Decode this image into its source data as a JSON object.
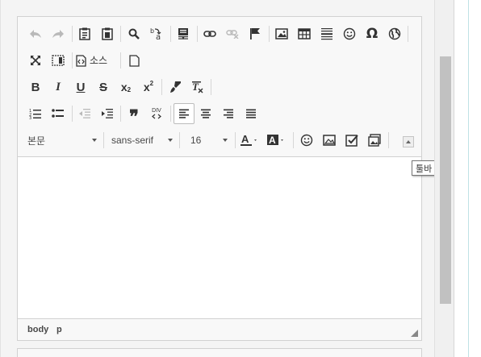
{
  "toolbar": {
    "source_label": "소스",
    "format_combo": "본문",
    "font_combo": "sans-serif",
    "size_combo": "16",
    "subscript_suffix": "2",
    "superscript_suffix": "2",
    "blockquote_glyph": "❞",
    "special_char_glyph": "Ω",
    "div_glyph": "DIV"
  },
  "status": {
    "path_body": "body",
    "path_p": "p"
  },
  "tooltip": {
    "collapse_toolbar": "툴바 줄이기"
  },
  "colors": {
    "toolbar_bg": "#f8f8f8",
    "border": "#d1d1d1",
    "icon": "#333333",
    "icon_disabled": "#b9b9b9",
    "scroll_thumb": "#c1c1c1"
  }
}
